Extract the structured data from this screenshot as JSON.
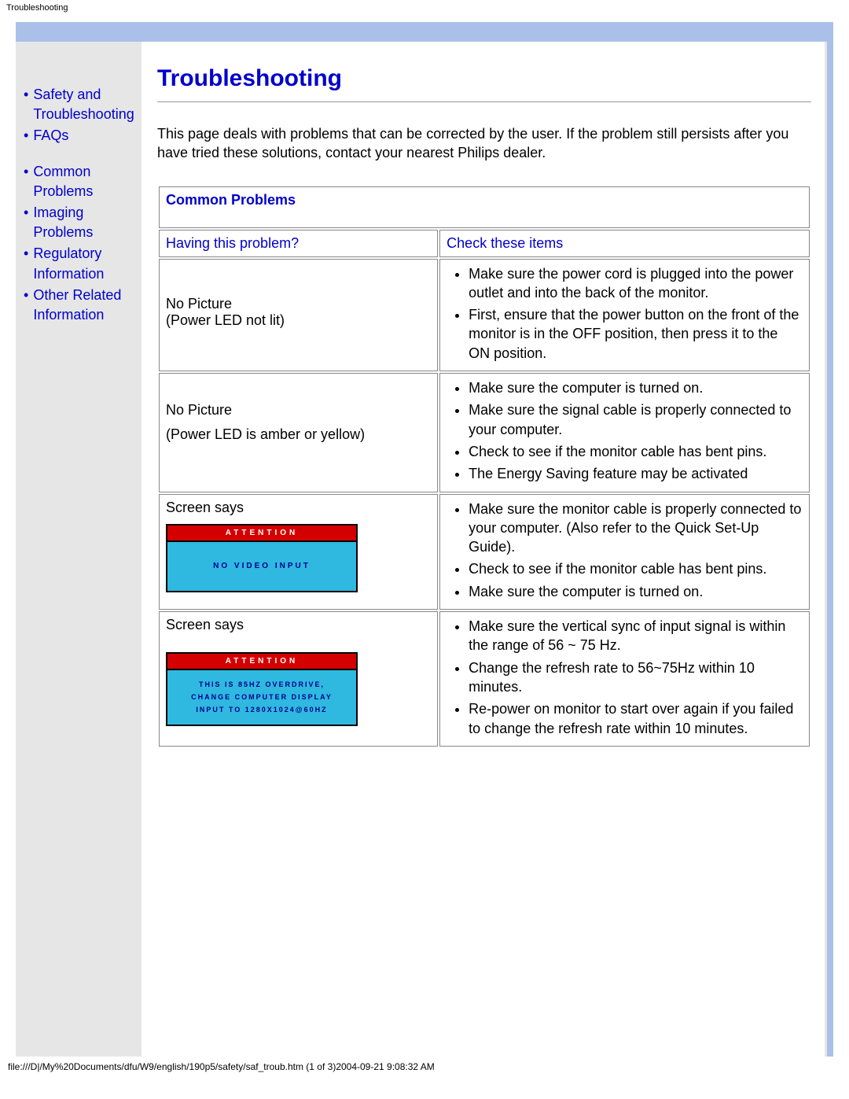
{
  "top_label": "Troubleshooting",
  "sidebar": {
    "items": [
      {
        "label": "Safety and Troubleshooting"
      },
      {
        "label": "FAQs"
      },
      {
        "label": "Common Problems"
      },
      {
        "label": "Imaging Problems"
      },
      {
        "label": "Regulatory Information"
      },
      {
        "label": "Other Related Information"
      }
    ]
  },
  "page": {
    "title": "Troubleshooting",
    "intro": "This page deals with problems that can be corrected by the user. If the problem still persists after you have tried these solutions, contact your nearest Philips dealer."
  },
  "table": {
    "section_title": "Common Problems",
    "col1_head": "Having this problem?",
    "col2_head": "Check these items",
    "rows": [
      {
        "problem_line1": "No Picture",
        "problem_line2": "(Power LED not lit)",
        "checks": [
          "Make sure the power cord is plugged into the power outlet and into the back of the monitor.",
          "First, ensure that the power button on the front of the monitor is in the OFF position, then press it to the ON position."
        ]
      },
      {
        "problem_line1": "No Picture",
        "problem_line2": "(Power LED is amber or yellow)",
        "checks": [
          "Make sure the computer is turned on.",
          "Make sure the signal cable is properly connected to your computer.",
          "Check to see if the monitor cable has bent pins.",
          "The Energy Saving feature may be activated"
        ]
      },
      {
        "problem_line1": "Screen says",
        "osd_title": "ATTENTION",
        "osd_body": "NO VIDEO INPUT",
        "checks": [
          "Make sure the monitor cable is properly connected to your computer. (Also refer to the Quick Set-Up Guide).",
          "Check to see if the monitor cable has bent pins.",
          "Make sure the computer is turned on."
        ]
      },
      {
        "problem_line1": "Screen says",
        "osd_title": "ATTENTION",
        "osd_body_l1": "THIS IS 85HZ OVERDRIVE,",
        "osd_body_l2": "CHANGE COMPUTER DISPLAY",
        "osd_body_l3": "INPUT TO 1280X1024@60HZ",
        "checks": [
          "Make sure the vertical sync of input signal is within the range of 56 ~ 75 Hz.",
          "Change the refresh rate to 56~75Hz within 10 minutes.",
          "Re-power on monitor to start over again if you failed to change the refresh rate within 10 minutes."
        ]
      }
    ]
  },
  "footer": "file:///D|/My%20Documents/dfu/W9/english/190p5/safety/saf_troub.htm (1 of 3)2004-09-21 9:08:32 AM"
}
